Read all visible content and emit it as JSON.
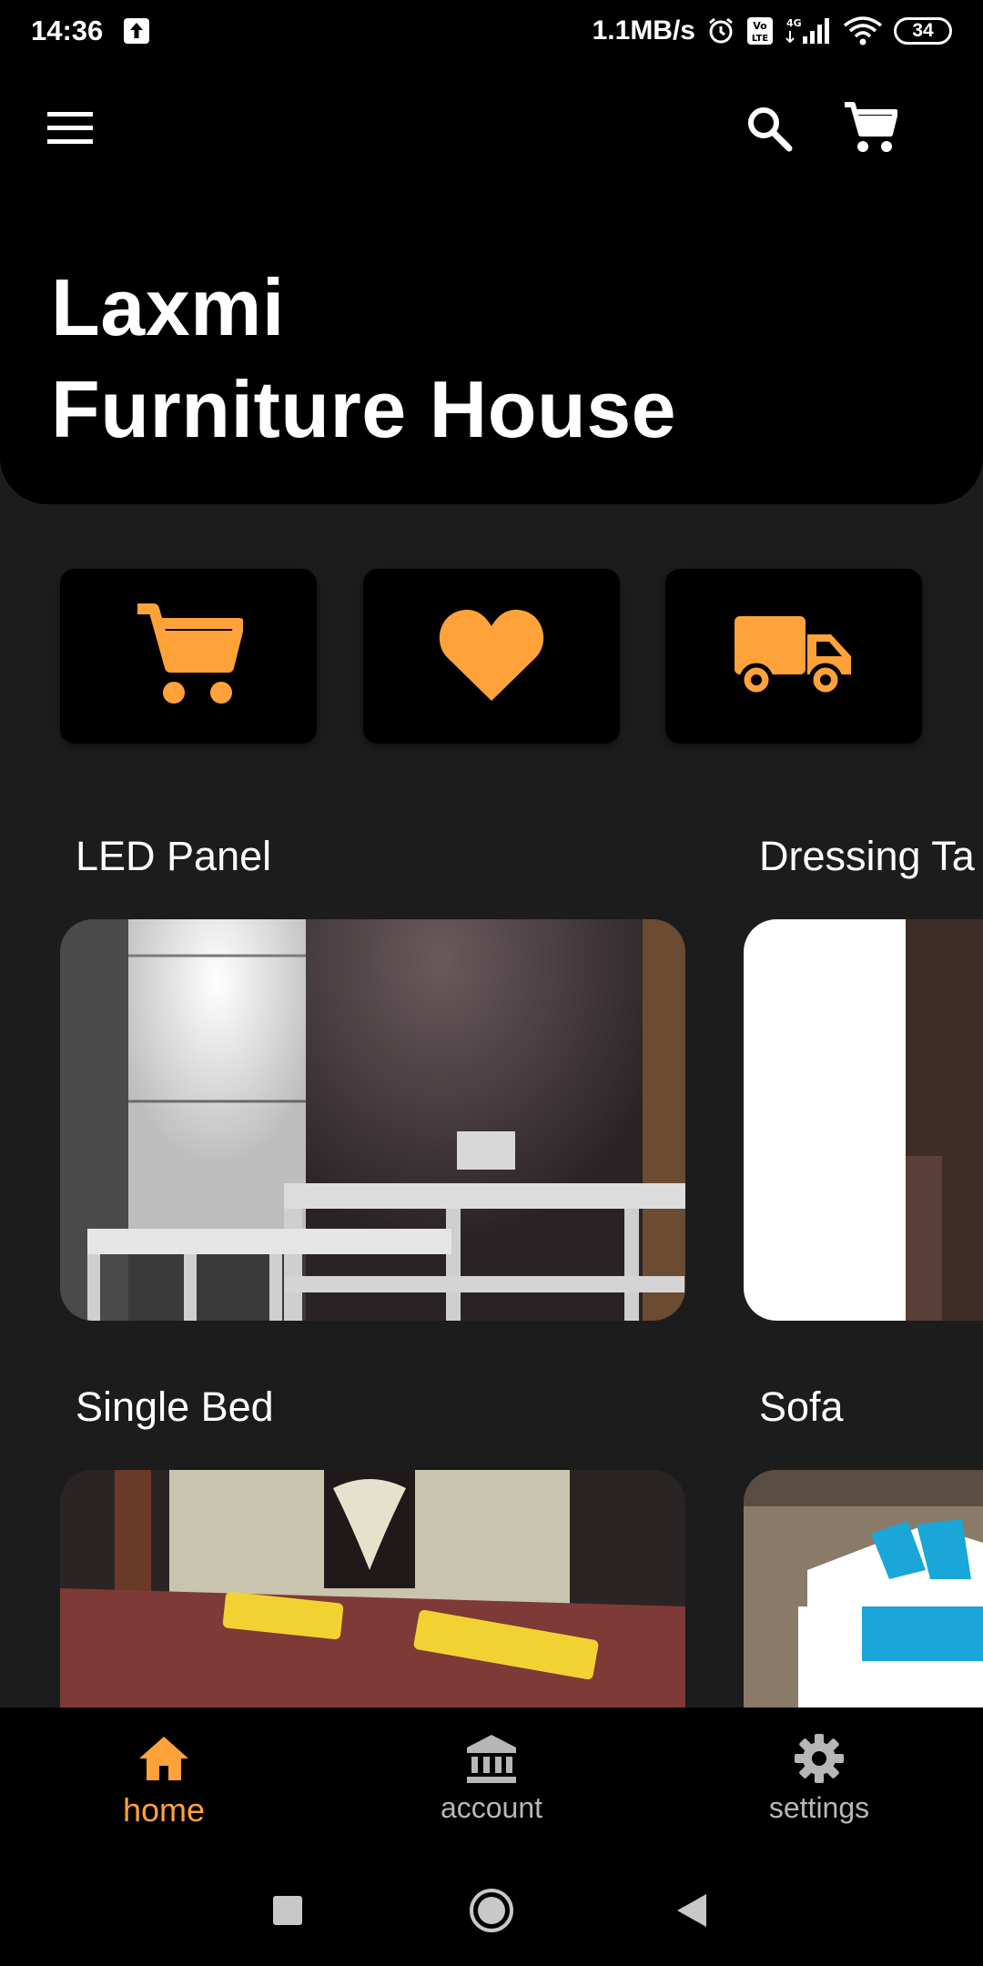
{
  "status_bar": {
    "time": "14:36",
    "network_speed": "1.1MB/s",
    "battery_level": "34",
    "icons": [
      "upload-icon",
      "alarm-icon",
      "volte-icon",
      "signal-4g-icon",
      "wifi-icon",
      "battery-icon"
    ]
  },
  "header": {
    "title_line1": "Laxmi",
    "title_line2": "Furniture House",
    "icons": [
      "menu-icon",
      "search-icon",
      "cart-icon"
    ]
  },
  "quick_actions": [
    {
      "icon": "cart-icon"
    },
    {
      "icon": "heart-icon"
    },
    {
      "icon": "truck-icon"
    }
  ],
  "categories": [
    {
      "label": "LED Panel"
    },
    {
      "label": "Dressing Ta"
    },
    {
      "label": "Single Bed"
    },
    {
      "label": "Sofa"
    }
  ],
  "bottom_nav": {
    "items": [
      {
        "label": "home",
        "icon": "home-icon",
        "active": true
      },
      {
        "label": "account",
        "icon": "bank-icon",
        "active": false
      },
      {
        "label": "settings",
        "icon": "gear-icon",
        "active": false
      }
    ]
  },
  "colors": {
    "accent": "#ffa23a",
    "background": "#1c1c1c",
    "surface": "#000000",
    "inactive_text": "#b7b7b7"
  }
}
